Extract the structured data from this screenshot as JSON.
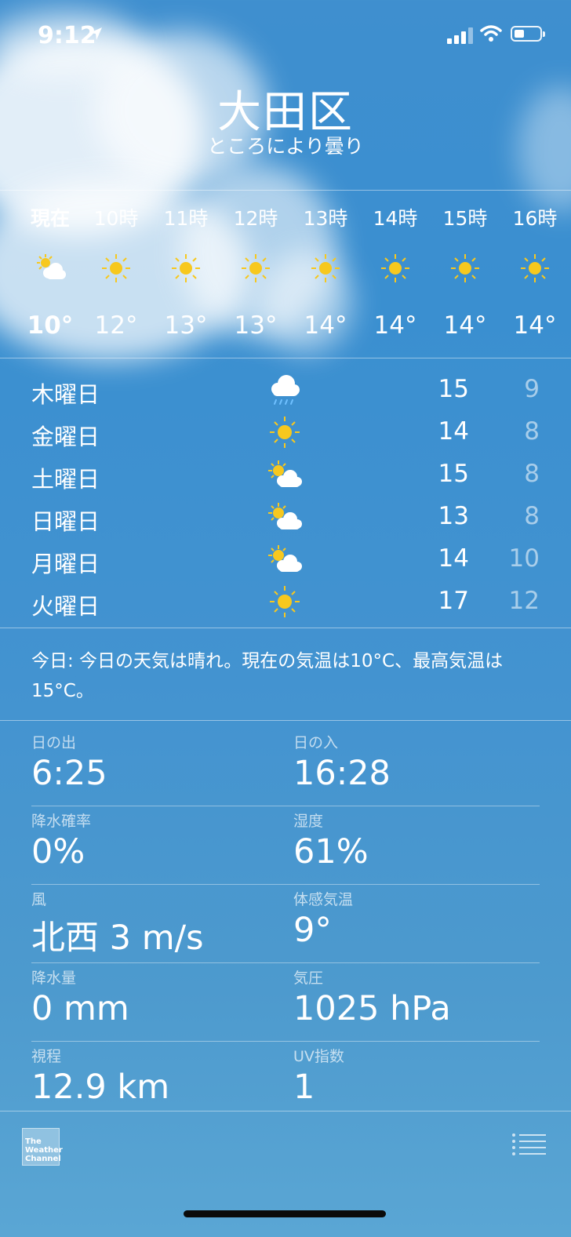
{
  "status_bar": {
    "time": "9:12"
  },
  "location": {
    "city": "大田区",
    "condition": "ところにより曇り"
  },
  "hourly": [
    {
      "label": "現在",
      "icon": "partly-cloudy-icon",
      "temp": "10°"
    },
    {
      "label": "10時",
      "icon": "sun-icon",
      "temp": "12°"
    },
    {
      "label": "11時",
      "icon": "sun-icon",
      "temp": "13°"
    },
    {
      "label": "12時",
      "icon": "sun-icon",
      "temp": "13°"
    },
    {
      "label": "13時",
      "icon": "sun-icon",
      "temp": "14°"
    },
    {
      "label": "14時",
      "icon": "sun-icon",
      "temp": "14°"
    },
    {
      "label": "15時",
      "icon": "sun-icon",
      "temp": "14°"
    },
    {
      "label": "16時",
      "icon": "sun-icon",
      "temp": "14°"
    }
  ],
  "daily": [
    {
      "day": "木曜日",
      "icon": "rain-cloud-icon",
      "high": "15",
      "low": "9"
    },
    {
      "day": "金曜日",
      "icon": "sun-icon",
      "high": "14",
      "low": "8"
    },
    {
      "day": "土曜日",
      "icon": "partly-cloudy-icon",
      "high": "15",
      "low": "8"
    },
    {
      "day": "日曜日",
      "icon": "partly-cloudy-icon",
      "high": "13",
      "low": "8"
    },
    {
      "day": "月曜日",
      "icon": "partly-cloudy-icon",
      "high": "14",
      "low": "10"
    },
    {
      "day": "火曜日",
      "icon": "sun-icon",
      "high": "17",
      "low": "12"
    }
  ],
  "summary": "今日: 今日の天気は晴れ。現在の気温は10°C、最高気温は15°C。",
  "details": [
    [
      {
        "label": "日の出",
        "value": "6:25"
      },
      {
        "label": "日の入",
        "value": "16:28"
      }
    ],
    [
      {
        "label": "降水確率",
        "value": "0%"
      },
      {
        "label": "湿度",
        "value": "61%"
      }
    ],
    [
      {
        "label": "風",
        "value": "北西 3 m/s"
      },
      {
        "label": "体感気温",
        "value": "9°"
      }
    ],
    [
      {
        "label": "降水量",
        "value": "0 mm"
      },
      {
        "label": "気圧",
        "value": "1025 hPa"
      }
    ],
    [
      {
        "label": "視程",
        "value": "12.9 km"
      },
      {
        "label": "UV指数",
        "value": "1"
      }
    ]
  ],
  "footer": {
    "logo_text": "The Weather Channel"
  },
  "colors": {
    "sun": "#f7c81e",
    "sky": "#3f8fcf"
  }
}
